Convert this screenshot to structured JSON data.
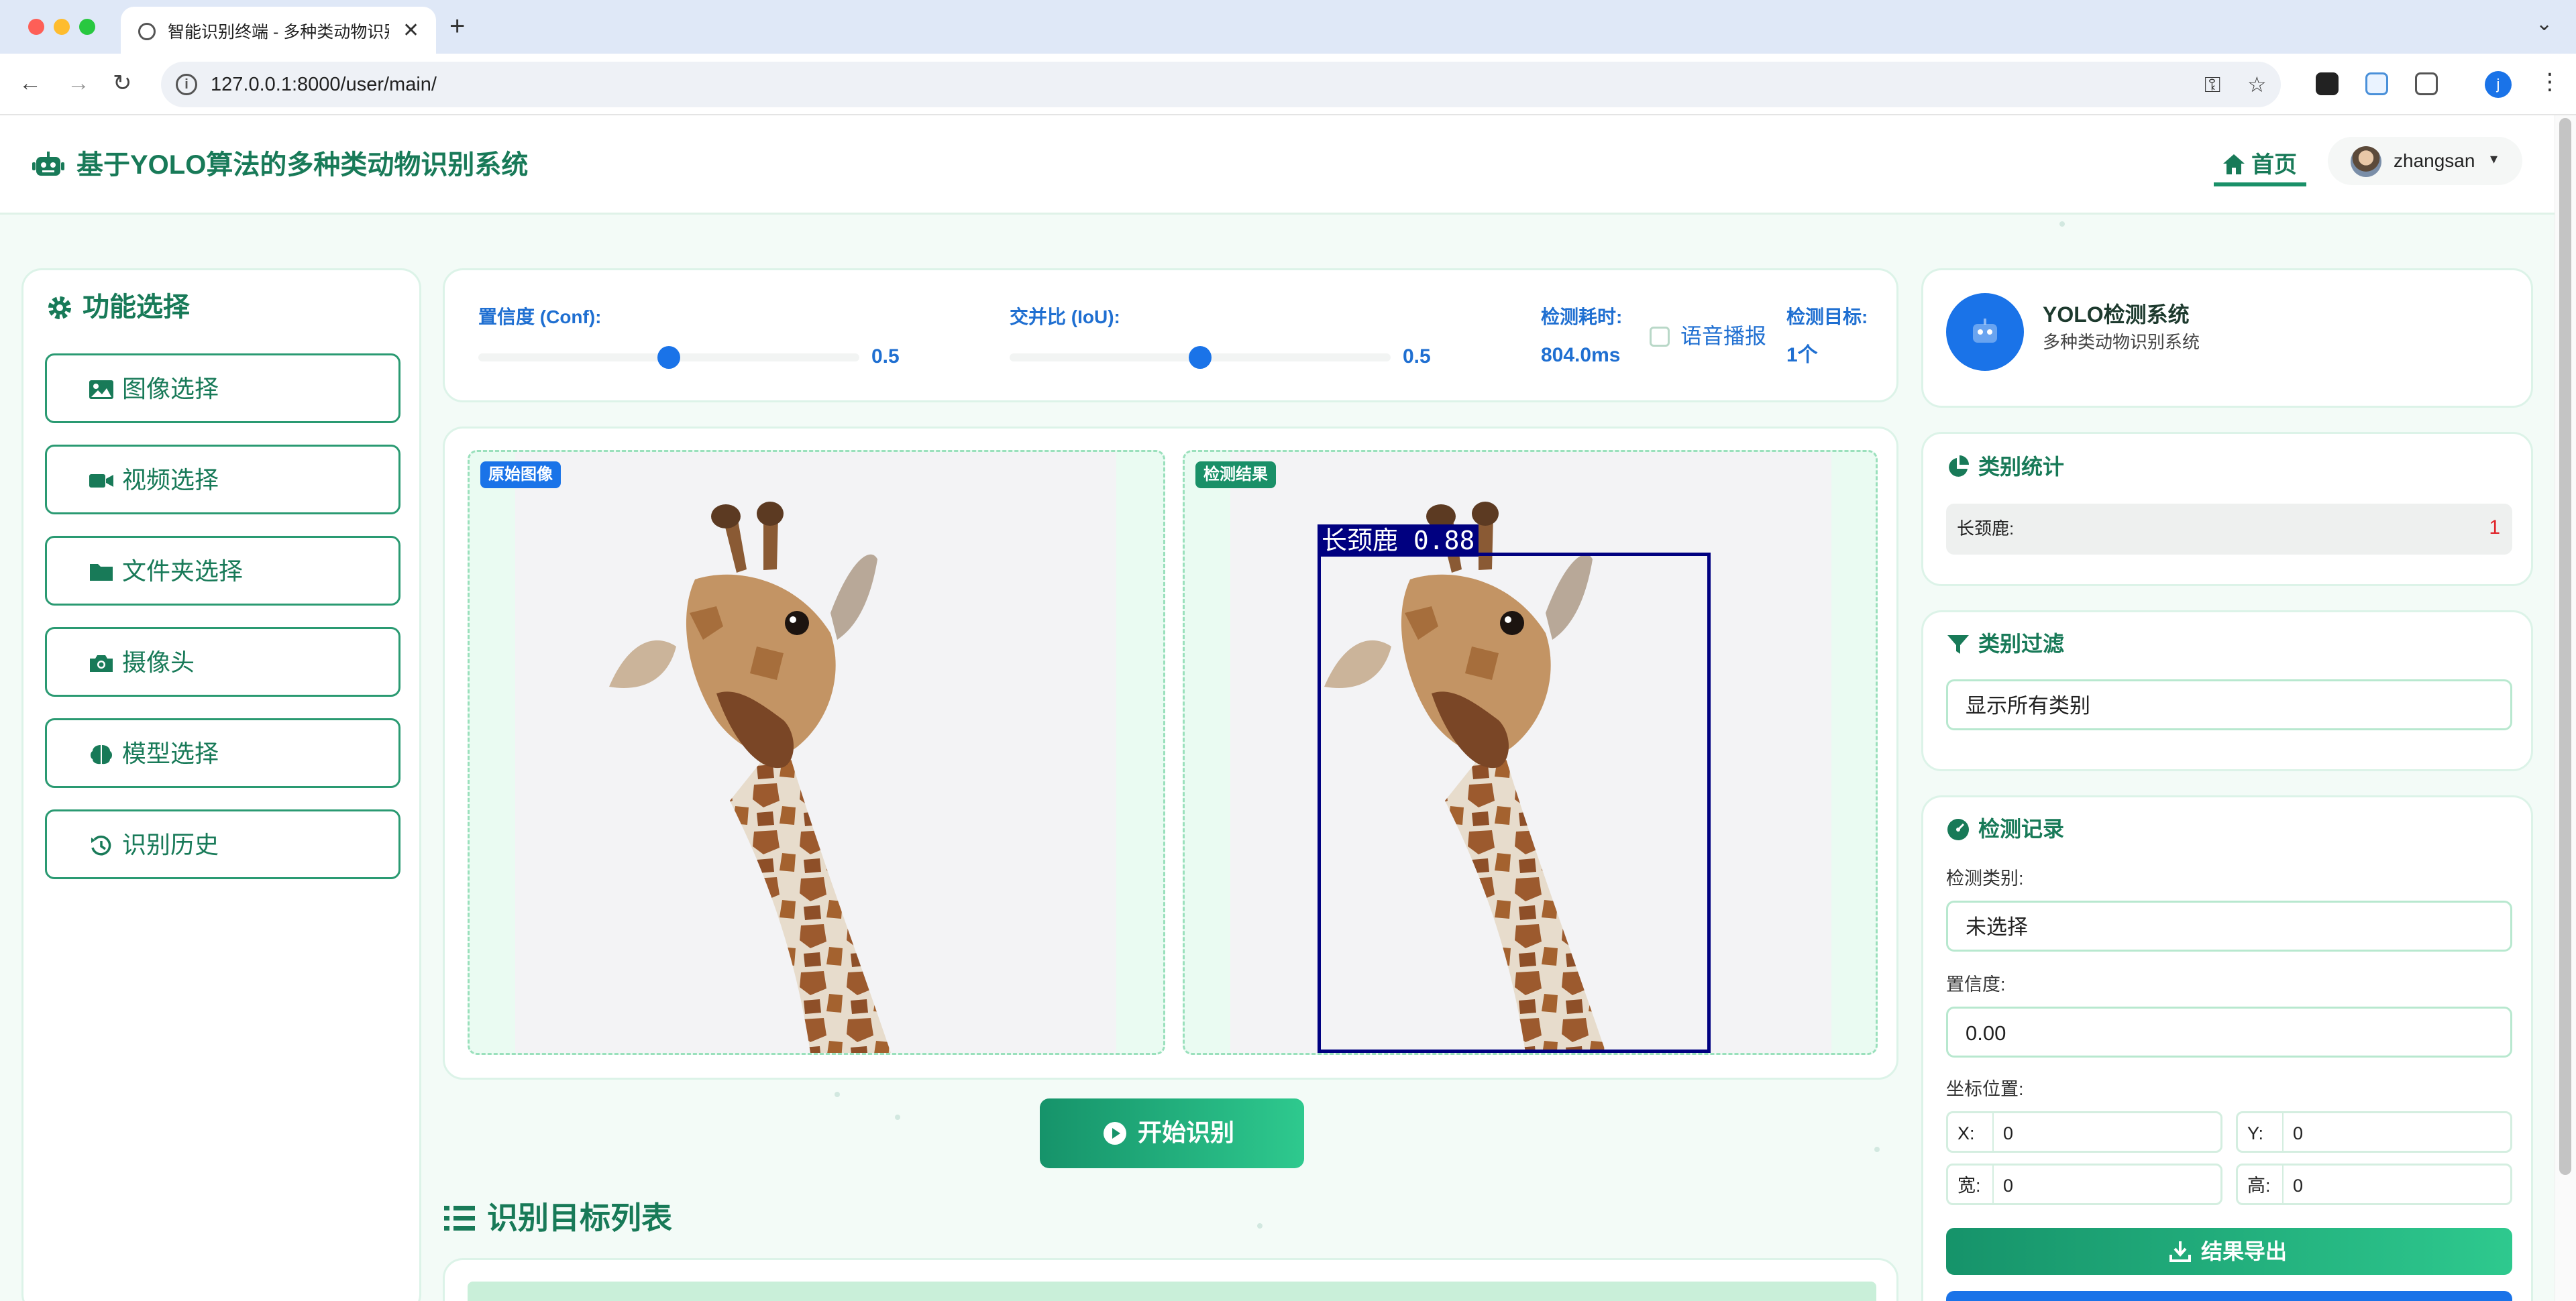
{
  "browser": {
    "tab_title": "智能识别终端 - 多种类动物识别",
    "url": "127.0.0.1:8000/user/main/",
    "profile_initial": "j"
  },
  "header": {
    "title": "基于YOLO算法的多种类动物识别系统",
    "home_label": "首页",
    "username": "zhangsan"
  },
  "sidebar": {
    "title": "功能选择",
    "items": [
      {
        "label": "图像选择",
        "icon": "image-icon"
      },
      {
        "label": "视频选择",
        "icon": "video-icon"
      },
      {
        "label": "文件夹选择",
        "icon": "folder-icon"
      },
      {
        "label": "摄像头",
        "icon": "camera-icon"
      },
      {
        "label": "模型选择",
        "icon": "brain-icon"
      },
      {
        "label": "识别历史",
        "icon": "history-icon"
      }
    ]
  },
  "controls": {
    "conf_label": "置信度 (Conf):",
    "conf_value": "0.5",
    "conf_fraction": 0.5,
    "iou_label": "交并比 (IoU):",
    "iou_value": "0.5",
    "iou_fraction": 0.5,
    "time_label": "检测耗时:",
    "time_value": "804.0ms",
    "voice_label": "语音播报",
    "voice_checked": false,
    "target_label": "检测目标:",
    "target_value": "1个"
  },
  "images": {
    "original_tag": "原始图像",
    "result_tag": "检测结果",
    "detection_label": "长颈鹿 0.88"
  },
  "start_button": "开始识别",
  "target_list": {
    "title": "识别目标列表"
  },
  "system": {
    "name": "YOLO检测系统",
    "subtitle": "多种类动物识别系统"
  },
  "stats": {
    "title": "类别统计",
    "rows": [
      {
        "name": "长颈鹿:",
        "count": "1"
      }
    ]
  },
  "filter": {
    "title": "类别过滤",
    "selected": "显示所有类别"
  },
  "record": {
    "title": "检测记录",
    "class_label": "检测类别:",
    "class_value": "未选择",
    "conf_label": "置信度:",
    "conf_value": "0.00",
    "coord_label": "坐标位置:",
    "x_label": "X:",
    "x_value": "0",
    "y_label": "Y:",
    "y_value": "0",
    "w_label": "宽:",
    "w_value": "0",
    "h_label": "高:",
    "h_value": "0",
    "export_label": "结果导出"
  },
  "colors": {
    "accent_green": "#187a58",
    "button_green": "#1a9068",
    "accent_blue": "#1a73e8",
    "detection_box": "#000080",
    "count_red": "#e0262c"
  }
}
